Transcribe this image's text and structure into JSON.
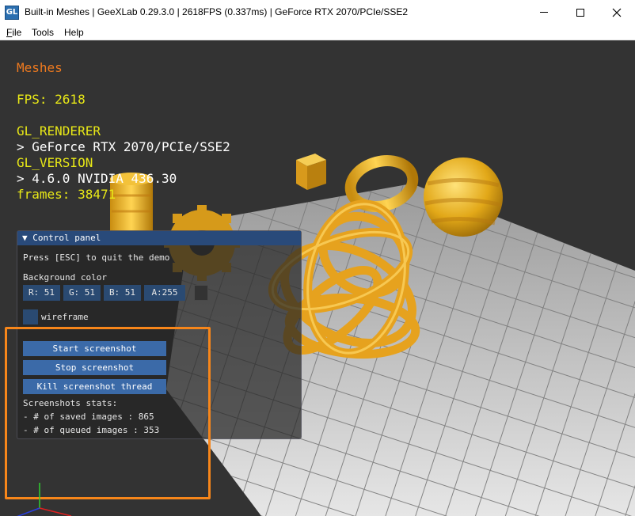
{
  "window": {
    "title": "Built-in Meshes | GeeXLab 0.29.3.0 | 2618FPS (0.337ms) | GeForce RTX 2070/PCIe/SSE2",
    "icon_glyph": "GL"
  },
  "menu": {
    "file": "File",
    "file_u": "F",
    "file_rest": "ile",
    "tools": "Tools",
    "help": "Help"
  },
  "overlay": {
    "title": "Meshes",
    "fps": "FPS: 2618",
    "gl_renderer_label": "GL_RENDERER",
    "gl_renderer_value": "> GeForce RTX 2070/PCIe/SSE2",
    "gl_version_label": "GL_VERSION",
    "gl_version_value": "> 4.6.0 NVIDIA 436.30",
    "frames": "frames: 38471"
  },
  "control_panel": {
    "header": "▼ Control panel",
    "esc_text": "Press [ESC] to quit the demo",
    "bg_label": "Background color",
    "color_fields": {
      "r": "R: 51",
      "g": "G: 51",
      "b": "B: 51",
      "a": "A:255"
    },
    "swatch_color": "#333333",
    "wireframe_label": "wireframe",
    "buttons": {
      "start": "Start screenshot",
      "stop": "Stop screenshot",
      "kill": "Kill screenshot thread"
    },
    "stats": {
      "title": "Screenshots stats:",
      "saved": "- # of saved images  : 865",
      "queued": "- # of queued images : 353"
    }
  },
  "colors": {
    "background": "#333333",
    "overlay_title": "#f07a1e",
    "overlay_yellow": "#e8e817",
    "panel_header": "#294a7a",
    "button": "#3b6aa8",
    "highlight": "#f7861a"
  }
}
